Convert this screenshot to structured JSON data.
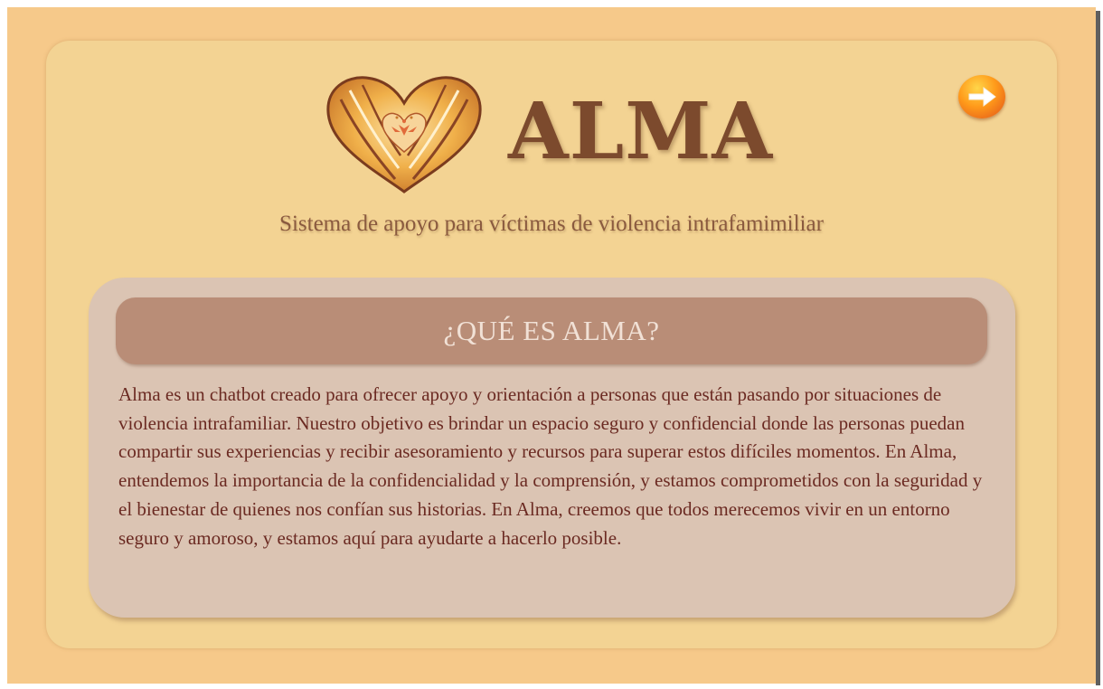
{
  "app": {
    "title": "ALMA",
    "subtitle": "Sistema de apoyo para víctimas de violencia intrafamimiliar"
  },
  "logo": {
    "icon": "heart-hands-logo-icon"
  },
  "navigation": {
    "next_icon": "arrow-right-icon"
  },
  "info": {
    "heading": "¿QUÉ ES ALMA?",
    "body": "Alma es un chatbot creado para ofrecer apoyo y orientación a personas que están pasando por situaciones de violencia intrafamiliar. Nuestro objetivo es brindar un espacio seguro y confidencial donde las personas puedan compartir sus experiencias y recibir asesoramiento y recursos para superar estos difíciles momentos. En Alma, entendemos la importancia de la confidencialidad y la comprensión, y estamos comprometidos con la seguridad y el bienestar de quienes nos confían sus historias. En Alma, creemos que todos merecemos vivir en un entorno seguro y amoroso, y estamos aquí para ayudarte a hacerlo posible."
  },
  "colors": {
    "page_background": "#f6c98a",
    "card_background": "#f3d393",
    "title": "#7c4a2d",
    "panel_background": "#dbc4b3",
    "panel_header": "#b98d77",
    "body_text": "#6b2a22",
    "accent": "#ff9a1a"
  }
}
